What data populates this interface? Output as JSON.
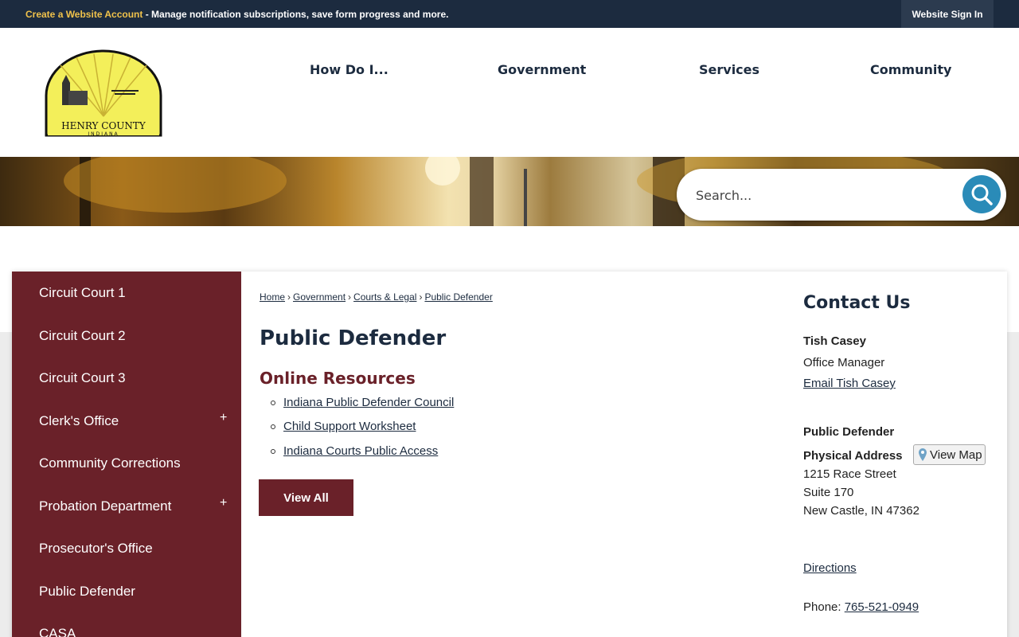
{
  "topbar": {
    "account_link": "Create a Website Account",
    "message": " - Manage notification subscriptions, save form progress and more.",
    "signin": "Website Sign In"
  },
  "logo": {
    "line1": "HENRY COUNTY",
    "line2": "INDIANA"
  },
  "nav": {
    "items": [
      "How Do I...",
      "Government",
      "Services",
      "Community"
    ]
  },
  "search": {
    "placeholder": "Search..."
  },
  "sidebar": {
    "items": [
      {
        "label": "Circuit Court 1"
      },
      {
        "label": "Circuit Court 2"
      },
      {
        "label": "Circuit Court 3"
      },
      {
        "label": "Clerk's Office",
        "expand": "+"
      },
      {
        "label": "Community Corrections"
      },
      {
        "label": "Probation Department",
        "expand": "+"
      },
      {
        "label": "Prosecutor's Office"
      },
      {
        "label": "Public Defender"
      },
      {
        "label": "CASA"
      }
    ]
  },
  "breadcrumb": {
    "items": [
      "Home",
      "Government",
      "Courts & Legal",
      "Public Defender"
    ],
    "separator": "›"
  },
  "main": {
    "title": "Public Defender",
    "section_title": "Online Resources",
    "resources": [
      "Indiana Public Defender Council",
      "Child Support Worksheet",
      "Indiana Courts Public Access"
    ],
    "view_all": "View All"
  },
  "contact": {
    "title": "Contact Us",
    "name": "Tish Casey",
    "role": "Office Manager",
    "email_link": "Email Tish Casey",
    "dept": "Public Defender",
    "address_label": "Physical Address",
    "view_map": "View Map",
    "address_line1": "1215 Race Street",
    "address_line2": "Suite 170",
    "address_line3": "New Castle, IN 47362",
    "directions": "Directions",
    "phone_label": "Phone: ",
    "phone": "765-521-0949"
  },
  "colors": {
    "topbar": "#1c2b3f",
    "accent_gold": "#f0c24b",
    "maroon": "#6a2129",
    "search_blue": "#2a8bb8"
  }
}
